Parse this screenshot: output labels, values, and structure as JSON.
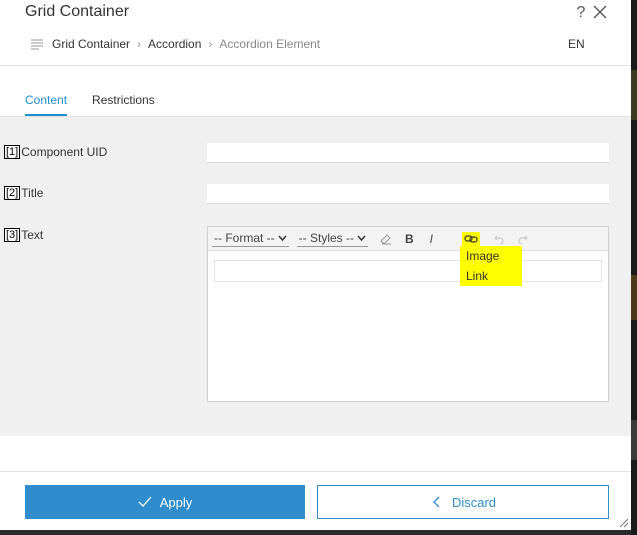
{
  "dialog": {
    "title": "Grid Container",
    "help_label": "?",
    "language": "EN"
  },
  "breadcrumb": {
    "items": [
      "Grid Container",
      "Accordion",
      "Accordion Element"
    ],
    "separator": "›"
  },
  "tabs": [
    {
      "label": "Content",
      "active": true
    },
    {
      "label": "Restrictions",
      "active": false
    }
  ],
  "fields": [
    {
      "tag": "[1]",
      "label": "Component UID",
      "value": ""
    },
    {
      "tag": "[2]",
      "label": "Title",
      "value": ""
    },
    {
      "tag": "[3]",
      "label": "Text"
    }
  ],
  "editor": {
    "format_select": "-- Format --",
    "styles_select": "-- Styles --",
    "bold_label": "B",
    "italic_label": "I",
    "icons": [
      "eraser-icon",
      "link-icon",
      "undo-icon",
      "redo-icon"
    ]
  },
  "link_dropdown": {
    "options": [
      "Image",
      "Link"
    ],
    "highlight_color": "#ffff00"
  },
  "footer": {
    "apply_label": "Apply",
    "discard_label": "Discard",
    "accent_color": "#2f8ccd"
  }
}
